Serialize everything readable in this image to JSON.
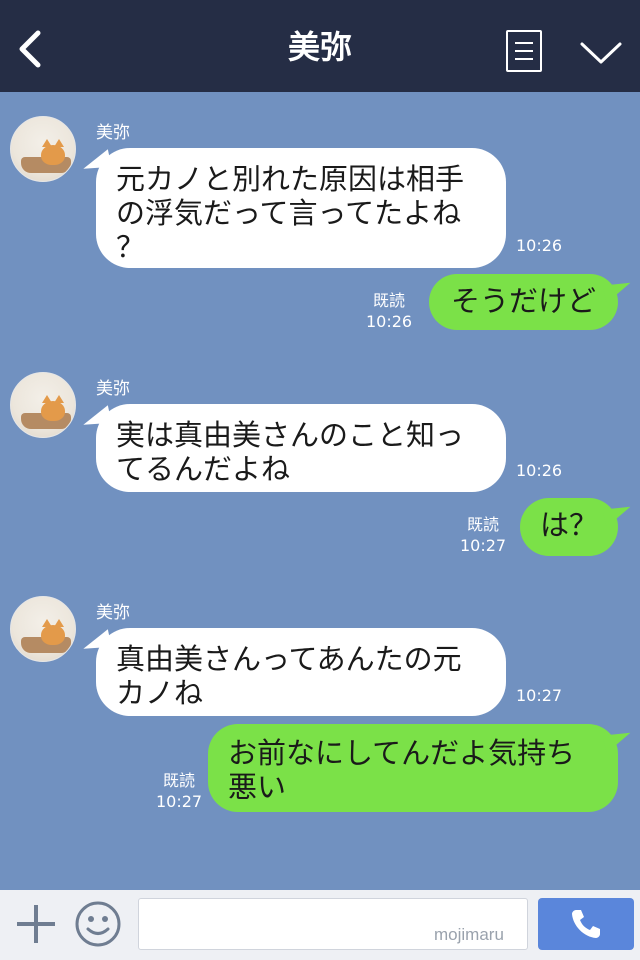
{
  "header": {
    "title": "美弥",
    "icons": {
      "back": "chevron-left-icon",
      "menu": "menu-icon",
      "more": "chevron-down-icon"
    }
  },
  "colors": {
    "header_bg": "#252d45",
    "chat_bg": "#7191c0",
    "incoming_bubble": "#ffffff",
    "outgoing_bubble": "#7be148",
    "call_button": "#5a86db"
  },
  "messages": [
    {
      "direction": "in",
      "sender": "美弥",
      "lines": [
        "元カノと別れた原因は相手",
        "の浮気だって言ってたよね",
        "？"
      ],
      "time": "10:26"
    },
    {
      "direction": "out",
      "text": "そうだけど",
      "read": "既読",
      "time": "10:26"
    },
    {
      "direction": "in",
      "sender": "美弥",
      "lines": [
        "実は真由美さんのこと知っ",
        "てるんだよね"
      ],
      "time": "10:26"
    },
    {
      "direction": "out",
      "text": "は？",
      "read": "既読",
      "time": "10:27"
    },
    {
      "direction": "in",
      "sender": "美弥",
      "lines": [
        "真由美さんってあんたの元",
        "カノね"
      ],
      "time": "10:27"
    },
    {
      "direction": "out",
      "lines": [
        "お前なにしてんだよ気持ち",
        "悪い"
      ],
      "read": "既読",
      "time": "10:27"
    }
  ],
  "footer": {
    "watermark": "mojimaru",
    "icons": {
      "add": "plus-icon",
      "sticker": "smile-icon",
      "call": "phone-icon"
    }
  }
}
